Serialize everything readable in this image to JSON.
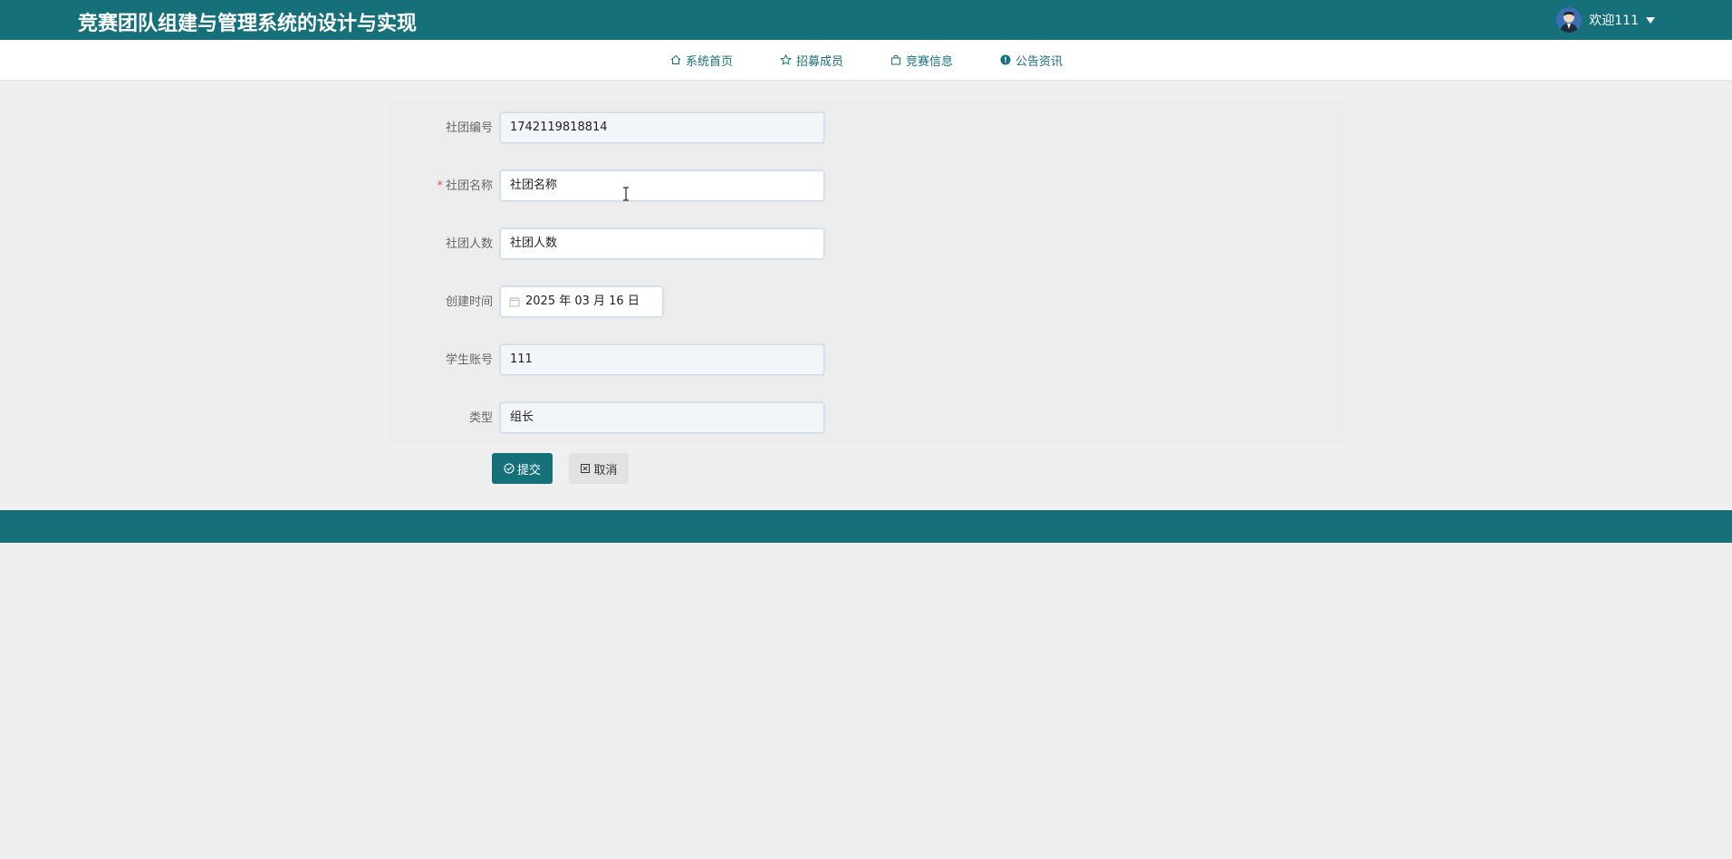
{
  "header": {
    "site_title": "竞赛团队组建与管理系统的设计与实现",
    "welcome_text": "欢迎111",
    "brand_color": "#16707a"
  },
  "nav": {
    "items": [
      {
        "label": "系统首页",
        "icon": "home-icon"
      },
      {
        "label": "招募成员",
        "icon": "star-icon"
      },
      {
        "label": "竞赛信息",
        "icon": "shopping-bag-icon"
      },
      {
        "label": "公告资讯",
        "icon": "info-circle-icon"
      }
    ]
  },
  "form": {
    "fields": [
      {
        "label": "社团编号",
        "value": "1742119818814",
        "required": false
      },
      {
        "label": "社团名称",
        "value": "社团名称",
        "required": true
      },
      {
        "label": "社团人数",
        "value": "社团人数",
        "required": false
      },
      {
        "label": "创建时间",
        "value": "2025 年 03 月 16 日",
        "required": false
      },
      {
        "label": "学生账号",
        "value": "111",
        "required": false
      },
      {
        "label": "类型",
        "value": "组长",
        "required": false
      }
    ],
    "required_mark": "*",
    "submit_label": "提交",
    "cancel_label": "取消"
  }
}
